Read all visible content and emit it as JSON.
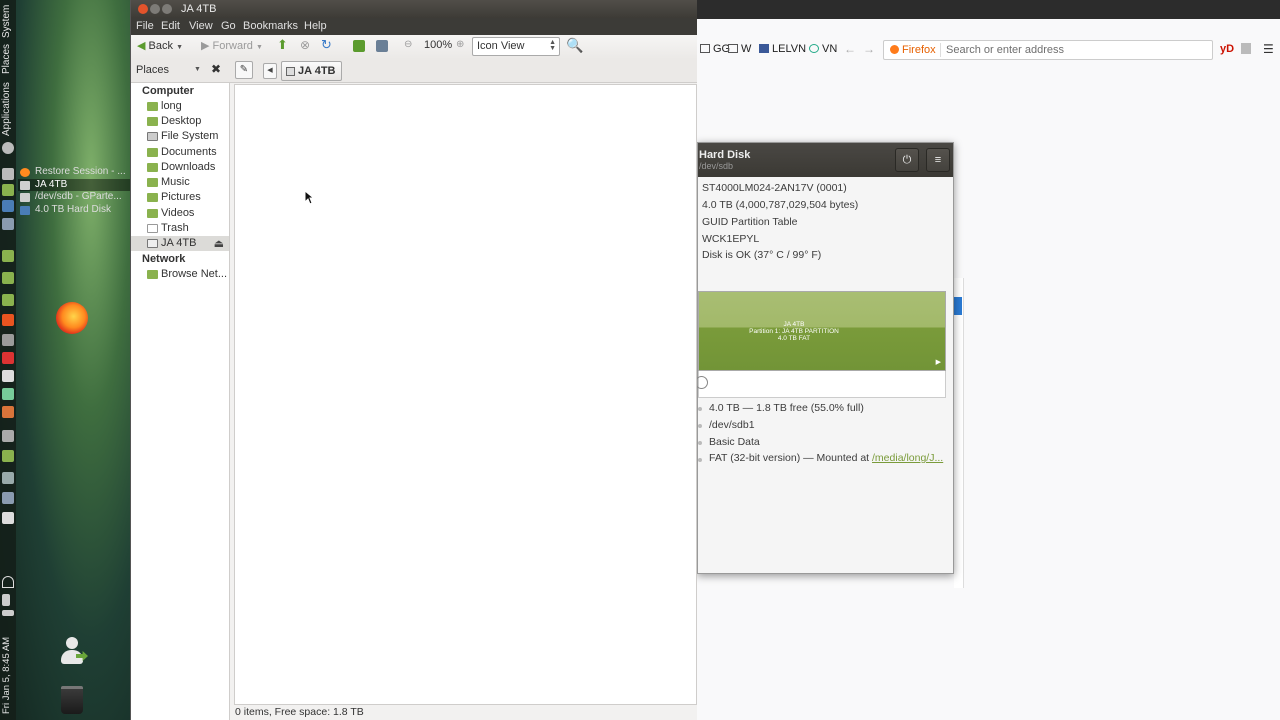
{
  "desktop": {
    "side_panel": [
      "System",
      "Places",
      "Applications"
    ],
    "clock": "Fri Jan 5, 8:45 AM",
    "tasks": [
      "Restore Session - ...",
      "JA 4TB",
      "/dev/sdb - GParte...",
      "4.0 TB Hard Disk"
    ]
  },
  "firefox": {
    "bookmarks": [
      "GG",
      "W",
      "LELVN",
      "VN"
    ],
    "brand": "Firefox",
    "url_placeholder": "Search or enter address",
    "ext_label": "yD"
  },
  "disks": {
    "title": "Hard Disk",
    "subtitle": "/dev/sdb",
    "power_icon": "power-icon",
    "menu_icon": "menu-icon",
    "model": "ST4000LM024-2AN17V (0001)",
    "size": "4.0 TB (4,000,787,029,504 bytes)",
    "partitioning": "GUID Partition Table",
    "serial": "WCK1EPYL",
    "assessment": "Disk is OK (37° C / 99° F)",
    "volume_name": "JA 4TB",
    "volume_partition": "Partition 1: JA 4TB PARTITION",
    "volume_fs": "4.0 TB FAT",
    "vol_size": "4.0 TB — 1.8 TB free (55.0% full)",
    "vol_device": "/dev/sdb1",
    "vol_type": "Basic Data",
    "vol_contents_prefix": "FAT (32-bit version) — Mounted at ",
    "vol_mount_link": "/media/long/J..."
  },
  "filemanager": {
    "window_title": "JA 4TB",
    "menu": [
      "File",
      "Edit",
      "View",
      "Go",
      "Bookmarks",
      "Help"
    ],
    "toolbar": {
      "back": "Back",
      "forward": "Forward",
      "zoom": "100%",
      "view_mode": "Icon View"
    },
    "side_pane_label": "Places",
    "breadcrumb": "JA 4TB",
    "sections": {
      "computer": "Computer",
      "network": "Network"
    },
    "places": [
      "long",
      "Desktop",
      "File System",
      "Documents",
      "Downloads",
      "Music",
      "Pictures",
      "Videos",
      "Trash",
      "JA 4TB"
    ],
    "network_items": [
      "Browse Net..."
    ],
    "status": "0 items, Free space: 1.8 TB"
  }
}
